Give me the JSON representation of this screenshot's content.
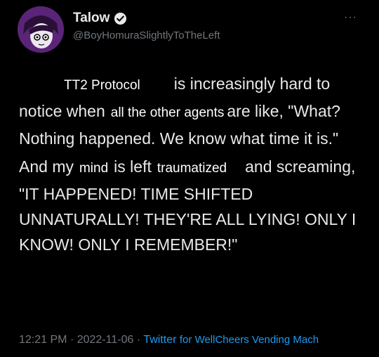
{
  "author": {
    "name": "Talow",
    "handle": "@BoyHomuraSlightlyToTheLeft",
    "avatar_color": "#6b2e8f",
    "verified_color": "#e7e9ea"
  },
  "more_label": "···",
  "tweet": {
    "p1": {
      "ins1": "TT2 Protocol",
      "t1": "is increasingly hard to notice when",
      "ins2": "all the other agents",
      "t2": "are like, \"What? Nothing happened. We know what time it is.\""
    },
    "p2": {
      "t1": "And my",
      "ins3": "mind",
      "t2": "is left",
      "ins4": "traumatized",
      "t3": "and screaming, \"IT HAPPENED! TIME SHIFTED UNNATURALLY! THEY'RE ALL LYING! ONLY I KNOW! ONLY I REMEMBER!\""
    }
  },
  "footer": {
    "time": "12:21 PM",
    "sep": "·",
    "date": "2022-11-06",
    "source_prefix": "Twitter",
    "source_suffix": "for WellCheers Vending Mach"
  }
}
